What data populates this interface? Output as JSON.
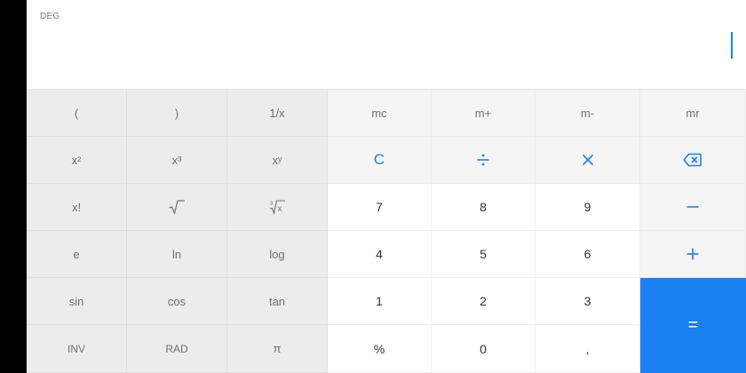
{
  "display": {
    "mode": "DEG",
    "value": ""
  },
  "keys": {
    "row1": [
      "(",
      ")",
      "1/x",
      "mc",
      "m+",
      "m-",
      "mr"
    ],
    "row2": {
      "sq": "x²",
      "cube": "x³",
      "pow": "xʸ",
      "clear": "C"
    },
    "row3": {
      "fact": "x!",
      "d7": "7",
      "d8": "8",
      "d9": "9"
    },
    "row4": {
      "e": "e",
      "ln": "ln",
      "log": "log",
      "d4": "4",
      "d5": "5",
      "d6": "6"
    },
    "row5": {
      "sin": "sin",
      "cos": "cos",
      "tan": "tan",
      "d1": "1",
      "d2": "2",
      "d3": "3",
      "equals": "="
    },
    "row6": {
      "inv": "INV",
      "rad": "RAD",
      "pi": "π",
      "percent": "%",
      "d0": "0",
      "decimal": ","
    }
  },
  "icons": {
    "sqrt": "square-root-icon",
    "cbrt": "cube-root-icon",
    "divide": "divide-icon",
    "multiply": "multiply-icon",
    "backspace": "backspace-icon",
    "minus": "minus-icon",
    "plus": "plus-icon"
  },
  "colors": {
    "accent": "#1a7ff0",
    "scientific_bg": "#ececec",
    "memory_bg": "#f5f5f5",
    "digit_bg": "#ffffff"
  }
}
